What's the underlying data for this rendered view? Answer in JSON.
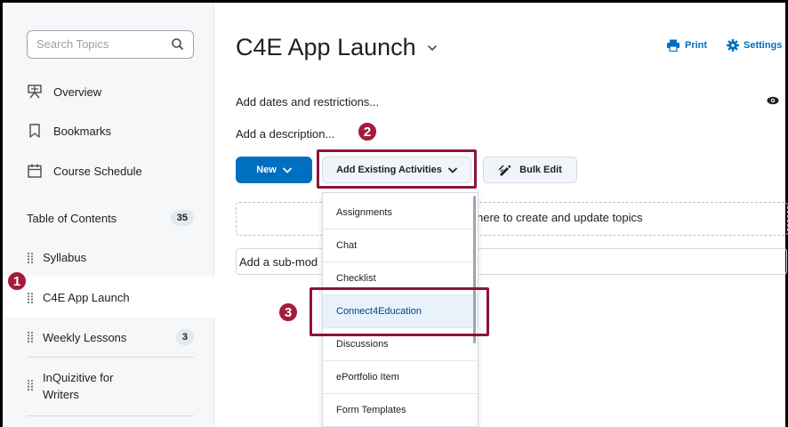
{
  "sidebar": {
    "search_placeholder": "Search Topics",
    "nav": [
      "Overview",
      "Bookmarks",
      "Course Schedule"
    ],
    "toc_label": "Table of Contents",
    "toc_count": "35",
    "toc_items": [
      {
        "label": "Syllabus"
      },
      {
        "label": "C4E App Launch"
      },
      {
        "label": "Weekly Lessons",
        "count": "3"
      },
      {
        "label_line1": "InQuizitive for",
        "label_line2": "Writers"
      }
    ]
  },
  "main": {
    "title": "C4E App Launch",
    "print_label": "Print",
    "settings_label": "Settings",
    "dates_text": "Add dates and restrictions...",
    "description_text": "Add a description...",
    "new_button": "New",
    "add_existing_button": "Add Existing Activities",
    "bulk_edit_button": "Bulk Edit",
    "dropzone_text": "here to create and update topics",
    "submodule_text": "Add a sub-mod"
  },
  "dropdown": {
    "items": [
      "Assignments",
      "Chat",
      "Checklist",
      "Connect4Education",
      "Discussions",
      "ePortfolio Item",
      "Form Templates"
    ],
    "selected": "Connect4Education"
  },
  "callouts": [
    "1",
    "2",
    "3"
  ],
  "colors": {
    "accent_blue": "#006fbf",
    "highlight_maroon": "#8a1538",
    "callout_red": "#a31d3a",
    "sidebar_bg": "#f6f7f8"
  }
}
